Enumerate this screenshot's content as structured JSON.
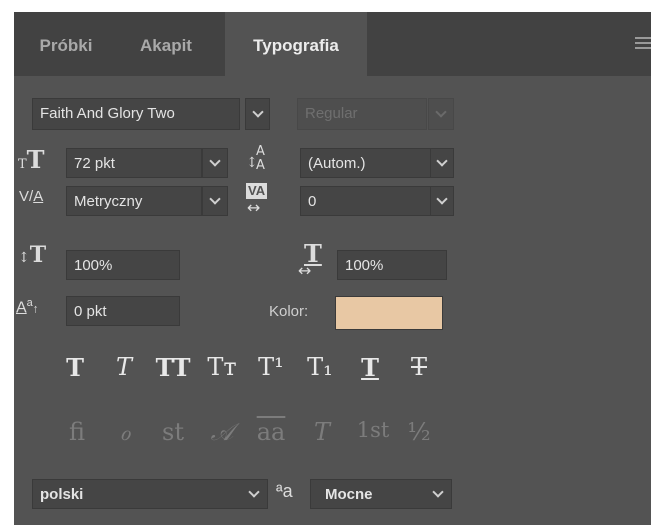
{
  "tabs": [
    {
      "label": "Próbki"
    },
    {
      "label": "Akapit"
    },
    {
      "label": "Typografia",
      "active": true
    }
  ],
  "font": {
    "family": "Faith And Glory Two",
    "style": "Regular"
  },
  "size": {
    "value": "72 pkt"
  },
  "leading": {
    "value": "(Autom.)"
  },
  "kerning": {
    "value": "Metryczny"
  },
  "tracking": {
    "value": "0"
  },
  "vertical_scale": {
    "value": "100%"
  },
  "horizontal_scale": {
    "value": "100%"
  },
  "baseline_shift": {
    "value": "0 pkt"
  },
  "color": {
    "label": "Kolor:",
    "value": "#e8c8a4"
  },
  "style_buttons": [
    {
      "name": "faux-bold",
      "glyph": "T"
    },
    {
      "name": "faux-italic",
      "glyph": "T"
    },
    {
      "name": "all-caps",
      "glyph": "TT"
    },
    {
      "name": "small-caps",
      "glyph": "Tт"
    },
    {
      "name": "superscript",
      "glyph": "T¹"
    },
    {
      "name": "subscript",
      "glyph": "T₁"
    },
    {
      "name": "underline",
      "glyph": "T"
    },
    {
      "name": "strikethrough",
      "glyph": "T"
    }
  ],
  "opentype_buttons": [
    {
      "name": "standard-ligatures",
      "glyph": "fi"
    },
    {
      "name": "contextual-alternates",
      "glyph": "ℴ"
    },
    {
      "name": "discretionary-ligatures",
      "glyph": "st"
    },
    {
      "name": "swash",
      "glyph": "𝒜"
    },
    {
      "name": "stylistic-alternates",
      "glyph": "aa"
    },
    {
      "name": "titling-alternates",
      "glyph": "T"
    },
    {
      "name": "ordinals",
      "glyph": "1st"
    },
    {
      "name": "fractions",
      "glyph": "½"
    }
  ],
  "language": {
    "value": "polski"
  },
  "antialiasing": {
    "icon_text": "ªa",
    "value": "Mocne"
  }
}
